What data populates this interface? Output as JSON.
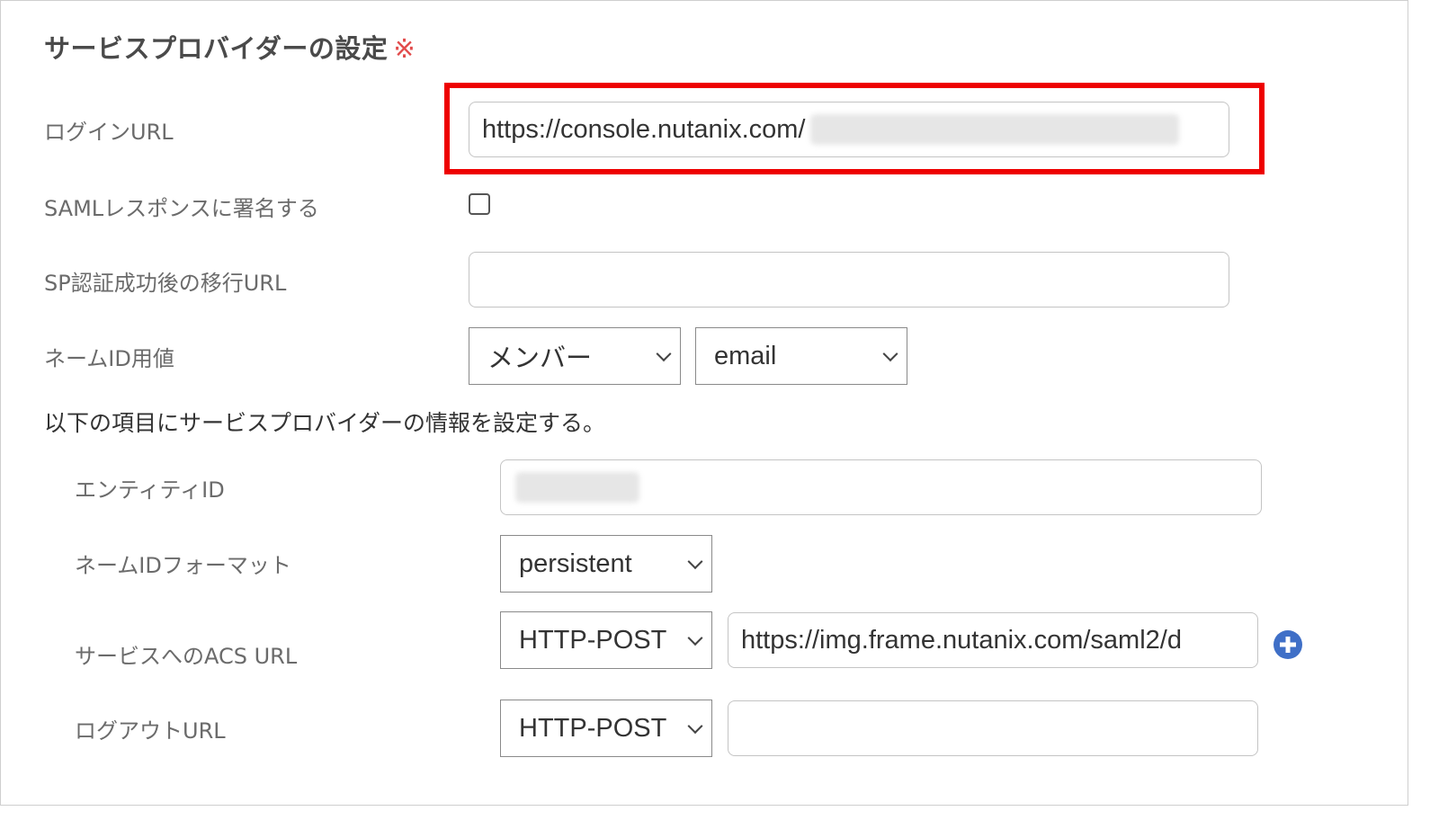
{
  "section": {
    "title": "サービスプロバイダーの設定",
    "required_mark": "※"
  },
  "fields": {
    "login_url": {
      "label": "ログインURL",
      "value": "https://console.nutanix.com/"
    },
    "sign_saml": {
      "label": "SAMLレスポンスに署名する",
      "checked": false
    },
    "redirect_url": {
      "label": "SP認証成功後の移行URL",
      "value": ""
    },
    "name_id": {
      "label": "ネームID用値",
      "select_1": "メンバー",
      "select_2": "email"
    }
  },
  "sp_info": {
    "description": "以下の項目にサービスプロバイダーの情報を設定する。",
    "entity_id": {
      "label": "エンティティID",
      "value": ""
    },
    "name_id_format": {
      "label": "ネームIDフォーマット",
      "selected": "persistent"
    },
    "acs_url": {
      "label": "サービスへのACS URL",
      "binding": "HTTP-POST",
      "value": "https://img.frame.nutanix.com/saml2/d"
    },
    "logout_url": {
      "label": "ログアウトURL",
      "binding": "HTTP-POST",
      "value": ""
    }
  },
  "colors": {
    "highlight": "#ee0000",
    "required": "#e24b4b",
    "add_button": "#3f6fc7"
  },
  "icons": {
    "add": "plus-circle-icon",
    "dropdown": "chevron-down-icon"
  }
}
